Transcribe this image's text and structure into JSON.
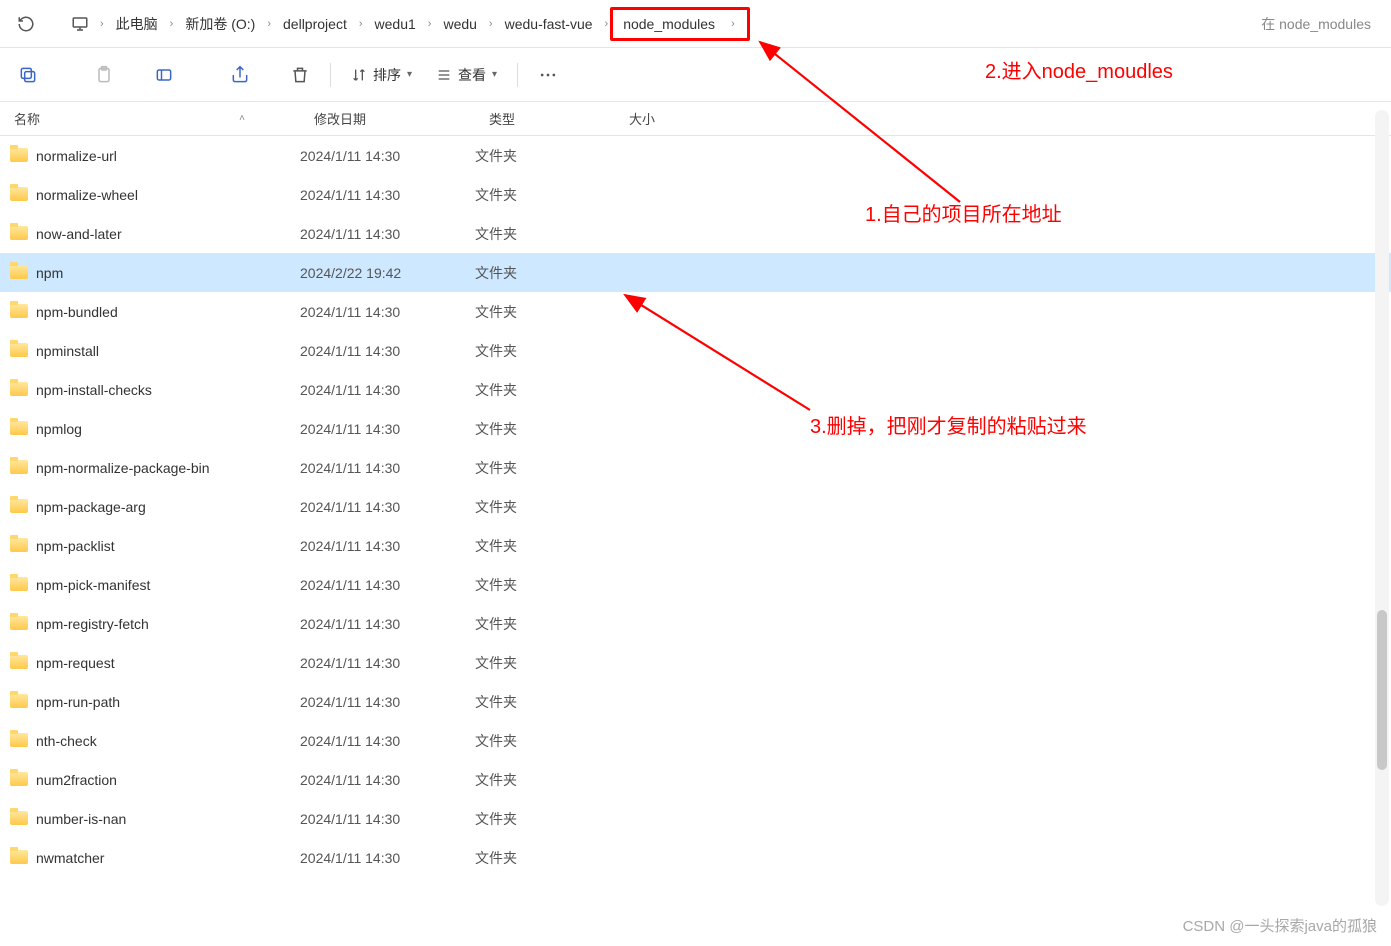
{
  "breadcrumb": {
    "items": [
      "此电脑",
      "新加卷 (O:)",
      "dellproject",
      "wedu1",
      "wedu",
      "wedu-fast-vue",
      "node_modules"
    ]
  },
  "search": {
    "placeholder": "在 node_modules"
  },
  "toolbar": {
    "sort": "排序",
    "view": "查看"
  },
  "columns": {
    "name": "名称",
    "date": "修改日期",
    "type": "类型",
    "size": "大小"
  },
  "type_folder": "文件夹",
  "files": [
    {
      "name": "normalize-url",
      "date": "2024/1/11 14:30",
      "selected": false
    },
    {
      "name": "normalize-wheel",
      "date": "2024/1/11 14:30",
      "selected": false
    },
    {
      "name": "now-and-later",
      "date": "2024/1/11 14:30",
      "selected": false
    },
    {
      "name": "npm",
      "date": "2024/2/22 19:42",
      "selected": true
    },
    {
      "name": "npm-bundled",
      "date": "2024/1/11 14:30",
      "selected": false
    },
    {
      "name": "npminstall",
      "date": "2024/1/11 14:30",
      "selected": false
    },
    {
      "name": "npm-install-checks",
      "date": "2024/1/11 14:30",
      "selected": false
    },
    {
      "name": "npmlog",
      "date": "2024/1/11 14:30",
      "selected": false
    },
    {
      "name": "npm-normalize-package-bin",
      "date": "2024/1/11 14:30",
      "selected": false
    },
    {
      "name": "npm-package-arg",
      "date": "2024/1/11 14:30",
      "selected": false
    },
    {
      "name": "npm-packlist",
      "date": "2024/1/11 14:30",
      "selected": false
    },
    {
      "name": "npm-pick-manifest",
      "date": "2024/1/11 14:30",
      "selected": false
    },
    {
      "name": "npm-registry-fetch",
      "date": "2024/1/11 14:30",
      "selected": false
    },
    {
      "name": "npm-request",
      "date": "2024/1/11 14:30",
      "selected": false
    },
    {
      "name": "npm-run-path",
      "date": "2024/1/11 14:30",
      "selected": false
    },
    {
      "name": "nth-check",
      "date": "2024/1/11 14:30",
      "selected": false
    },
    {
      "name": "num2fraction",
      "date": "2024/1/11 14:30",
      "selected": false
    },
    {
      "name": "number-is-nan",
      "date": "2024/1/11 14:30",
      "selected": false
    },
    {
      "name": "nwmatcher",
      "date": "2024/1/11 14:30",
      "selected": false
    }
  ],
  "annotations": {
    "a1": "1.自己的项目所在地址",
    "a2": "2.进入node_moudles",
    "a3": "3.删掉，把刚才复制的粘贴过来"
  },
  "watermark": "CSDN @一头探索java的孤狼"
}
